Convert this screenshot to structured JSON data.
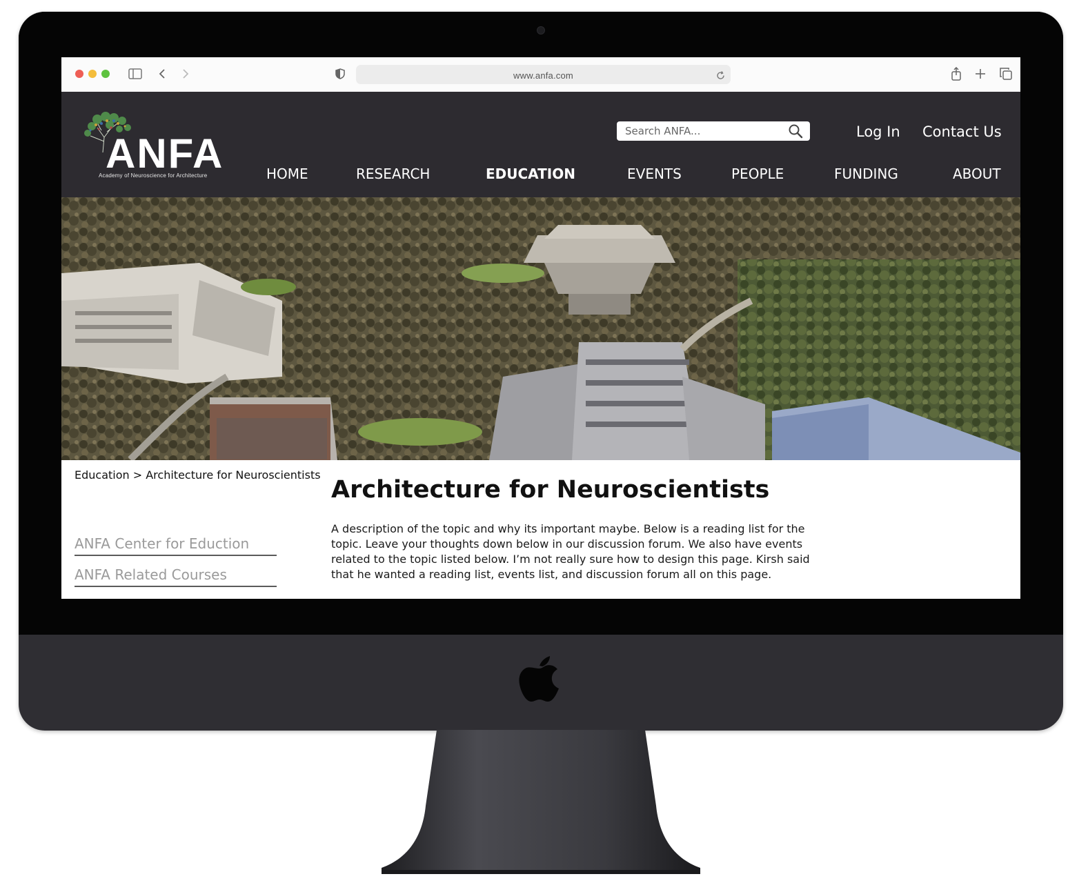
{
  "browser": {
    "url": "www.anfa.com"
  },
  "site": {
    "logo": {
      "wordmark": "ANFA",
      "tagline": "Academy of Neuroscience for Architecture"
    },
    "search": {
      "placeholder": "Search ANFA..."
    },
    "top_links": [
      "Log In",
      "Contact Us"
    ],
    "nav": [
      {
        "label": "HOME",
        "active": false
      },
      {
        "label": "RESEARCH",
        "active": false
      },
      {
        "label": "EDUCATION",
        "active": true
      },
      {
        "label": "EVENTS",
        "active": false
      },
      {
        "label": "PEOPLE",
        "active": false
      },
      {
        "label": "FUNDING",
        "active": false
      },
      {
        "label": "ABOUT",
        "active": false
      }
    ]
  },
  "content": {
    "breadcrumb": "Education > Architecture for Neuroscientists",
    "sidebar": [
      "ANFA Center for Eduction",
      "ANFA Related Courses"
    ],
    "title": "Architecture for Neuroscientists",
    "description": "A description of the topic and why its important maybe. Below is a reading list for the topic. Leave your thoughts down below in our discussion forum. We also have events related to the topic listed below. I’m not really sure how to design this page. Kirsh said that he wanted a reading list, events list, and discussion forum all on this page."
  },
  "colors": {
    "header_bg": "#2d2b30",
    "device_frame": "#2f2e33",
    "sidebar_link": "#9a9a9a"
  }
}
